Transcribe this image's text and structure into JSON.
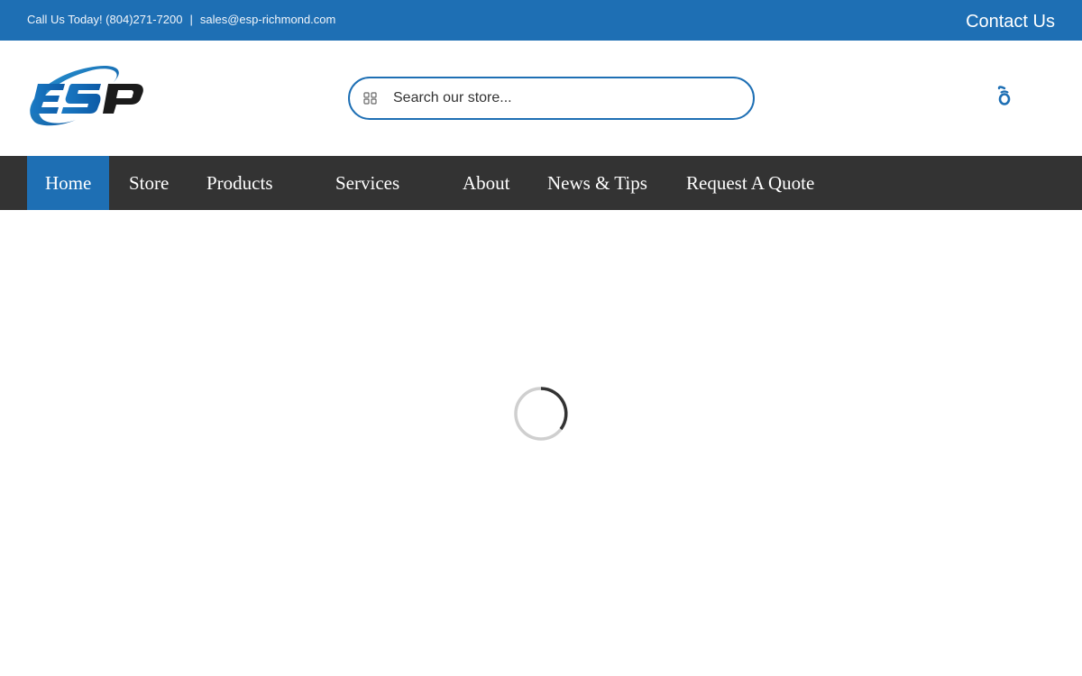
{
  "topbar": {
    "phone_text": "Call Us Today! (804)271-7200",
    "separator": "|",
    "email": "sales@esp-richmond.com",
    "contact_label": "Contact Us"
  },
  "header": {
    "logo_text": "ESP",
    "search": {
      "placeholder": "Search our store...",
      "value": ""
    },
    "cart_icon": "cart-icon"
  },
  "nav": {
    "items": [
      {
        "label": "Home",
        "active": true
      },
      {
        "label": "Store",
        "active": false
      },
      {
        "label": "Products",
        "active": false
      },
      {
        "label": "Services",
        "active": false
      },
      {
        "label": "About",
        "active": false
      },
      {
        "label": "News & Tips",
        "active": false
      },
      {
        "label": "Request A Quote",
        "active": false
      }
    ]
  },
  "main": {
    "loading_icon": "loading-spinner-icon"
  },
  "colors": {
    "brand_blue": "#1e6fb4",
    "nav_background": "#333333",
    "page_background": "#ffffff"
  }
}
